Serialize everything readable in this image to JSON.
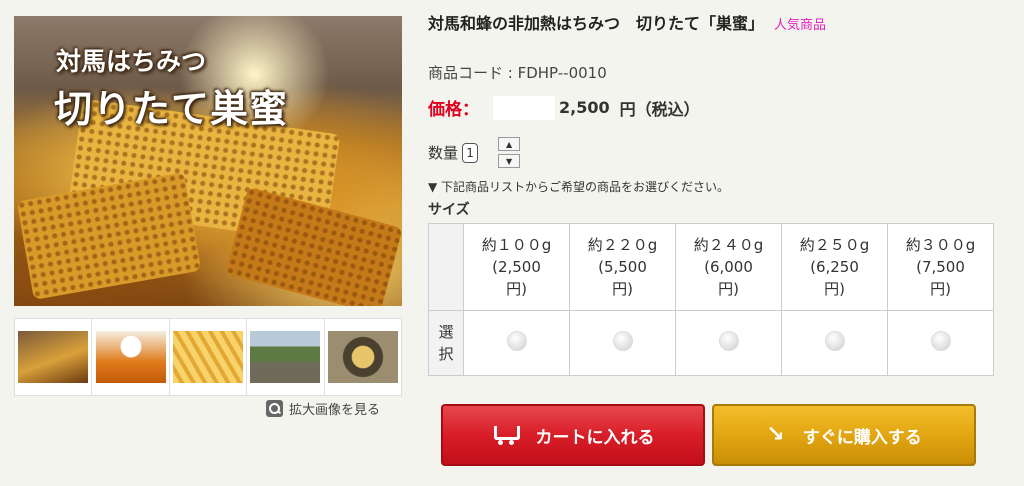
{
  "gallery": {
    "main_image_text_line1": "対馬はちみつ",
    "main_image_text_line2": "切りたて巣蜜",
    "thumbnails": [
      "comb-pieces",
      "honey-bowl",
      "honeycomb-closeup",
      "hive-outdoor",
      "hive-top"
    ],
    "zoom_label": "拡大画像を見る"
  },
  "product": {
    "title": "対馬和蜂の非加熱はちみつ　切りたて「巣蜜」",
    "badge": "人気商品",
    "code": "商品コード : FDHP--0010",
    "price_label": "価格：",
    "price_value": "2,500",
    "price_unit": "円（税込）",
    "quantity_label": "数量",
    "quantity_value": "1",
    "notice": "▼ 下記商品リストからご希望の商品をお選びください。",
    "size_label": "サイズ"
  },
  "options": {
    "row_header_top": "",
    "row_header_select": "選\n択",
    "items": [
      {
        "weight": "約１００g",
        "price": "(2,500",
        "unit": "円)"
      },
      {
        "weight": "約２２０g",
        "price": "(5,500",
        "unit": "円)"
      },
      {
        "weight": "約２４０g",
        "price": "(6,000",
        "unit": "円)"
      },
      {
        "weight": "約２５０g",
        "price": "(6,250",
        "unit": "円)"
      },
      {
        "weight": "約３００g",
        "price": "(7,500",
        "unit": "円)"
      }
    ]
  },
  "actions": {
    "cart_label": "カートに入れる",
    "buy_label": "すぐに購入する"
  },
  "colors": {
    "price_red": "#e00020",
    "badge_pink": "#e020c0",
    "cart_button": "#d81e28",
    "buy_button": "#e0a410"
  }
}
